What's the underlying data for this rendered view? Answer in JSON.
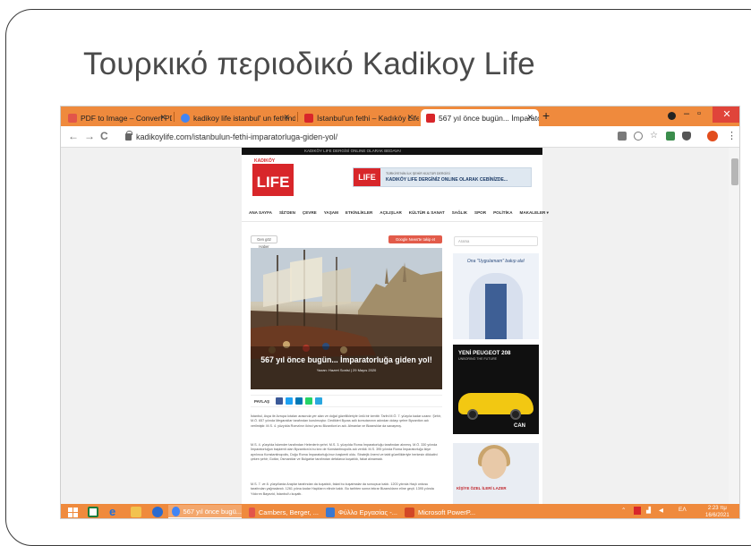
{
  "slide": {
    "title": "Τουρκικό περιοδικό Kadikoy Life"
  },
  "browser": {
    "tabs": [
      {
        "label": "PDF to Image – Convert PDF to",
        "favicon_color": "#e2554a",
        "active": false
      },
      {
        "label": "kadikoy life istanbul' un fethindi",
        "favicon_color": "#4285f4",
        "active": false
      },
      {
        "label": "İstanbul'un fethi – Kadıköy Life",
        "favicon_color": "#d8262a",
        "active": false
      },
      {
        "label": "567 yıl önce bugün... İmparatorl",
        "favicon_color": "#d8262a",
        "active": true
      }
    ],
    "new_tab_glyph": "+",
    "url": "kadikoylife.com/istanbulun-fethi-imparatorluga-giden-yol/",
    "back_glyph": "←",
    "forward_glyph": "→",
    "reload_glyph": "C",
    "minimize_glyph": "–",
    "restore_glyph": "▫",
    "close_glyph": "✕",
    "menu_glyph": "⋮"
  },
  "site": {
    "top_strip_text": "KADIKÖY LIFE DERGİSİ ONLINE OLARAK BEDAVA!",
    "logo_small": "KADIKÖY",
    "logo_text": "LIFE",
    "banner_logo": "LIFE",
    "banner_text_1": "TÜRKİYE'NİN İLK ŞEHİR KÜLTÜR DERGİSİ",
    "banner_text_2": "KADIKÖY LIFE DERGİNİZ ONLINE OLARAK CEBİNİZDE...",
    "menu": [
      "ANA SAYFA",
      "SİZ'DEN",
      "ÇEVRE",
      "YAŞAM",
      "ETKİNLİKLER",
      "AÇILIŞLAR",
      "KÜLTÜR & SANAT",
      "SAĞLIK",
      "SPOR",
      "POLİTİKA",
      "MAKALELER ▾"
    ],
    "left_button": "Gen göz Haber",
    "gnews_button": "Google News'te takip et",
    "search_placeholder": "Arama",
    "article_title": "567 yıl önce bugün... İmparatorluğa giden yol!",
    "article_meta": "Yazan: Hazret Sonisi  |  29 Mayıs 2020",
    "share_label": "PAYLAŞ",
    "share_colors": [
      "#3b5998",
      "#1da1f2",
      "#0077b5",
      "#25d366",
      "#2aa7e0"
    ],
    "paragraph_1": "İstanbul, Asya ile Avrupa kıtaları arasında yer alan ve doğal güzellikleriyle ünlü bir kenttir. Tarihi M.Ö. 7. yüzyıla kadar uzanır. Şehir, M.Ö. 657 yılında Megaralılar tarafından kurulmuştur. Dedikleri Byzas adlı komutanının adından dolayı şehre Byzantion adı verilmiştir. M.S. 4. yüzyılda Roma'nın ikinci yarısı Bizantion'un adı. Almanlar ve Bizanslılar da savaşmış.",
    "paragraph_2": "M.S. 4. yüzyılda İskender tarafından Helenlerin şehri. M.S. 3. yüzyılda Roma İmparatorluğu tarafından alınmış. M.Ö. 330 yılında İmparatorluğun başkenti olan Byzantion'a bu kez de Konstantinopolis adı verildi. M.S. 395 yılında Roma İmparatorluğu ikiye ayrılınca Konstantinopolis, Doğu Roma İmparatorluğu'nun başkenti oldu. Stratejik önemi ve tabii güzellikleriyle herkesin dikkatini çeken şehir; Gotlar, Osmanlılar ve Bulgarlar tarafından defalarca kuşatıldı, fakat alınamadı.",
    "paragraph_3": "M.S. 7. ve 8. yüzyıllarda Araplar tarafından da kuşatıldı, fakat bu kuşatmalar da sonuçsuz kaldı. 1203 yılında Haçlı ordusu tarafından yağmalandı. 1261 yılına kadar Haçlıların elinde kaldı. Bu tarihten sonra tekrar Bizanslıların eline geçti. 1395 yılında Yıldırım Bayezid, İstanbul'u kuşattı.",
    "ad1_title": "Ona \"Uygulamam\" bakıp ala!",
    "ad2_title": "YENİ PEUGEOT 208",
    "ad2_sub": "UNBORING THE FUTURE",
    "ad2_dealer": "CAN",
    "ad3_text": "KİŞİYE ÖZEL İLERİ LAZER"
  },
  "taskbar": {
    "apps": [
      {
        "label": "567 yıl önce bugü...",
        "color": "#4285f4",
        "active": true
      },
      {
        "label": "Cambers, Berger, ...",
        "color": "#e2554a",
        "active": false
      },
      {
        "label": "Φύλλο Εργασίας -...",
        "color": "#3b78d0",
        "active": false
      },
      {
        "label": "Microsoft PowerP...",
        "color": "#d24726",
        "active": false
      }
    ],
    "tray_lang": "EΛ",
    "clock_time": "2:23 πμ",
    "clock_date": "16/6/2021"
  }
}
